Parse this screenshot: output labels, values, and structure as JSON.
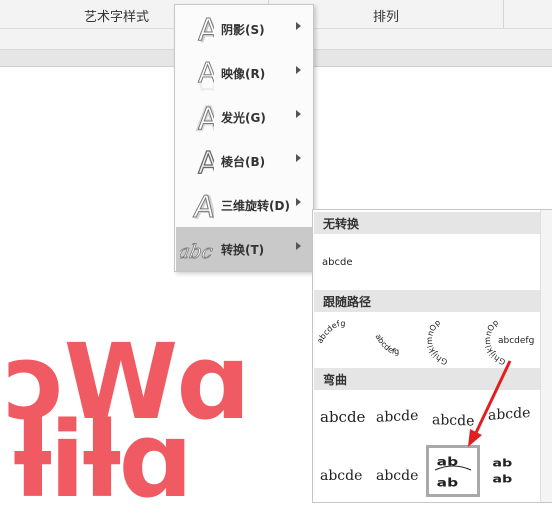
{
  "ribbon": {
    "group_wordart_styles": "艺术字样式",
    "group_arrange": "排列"
  },
  "canvas": {
    "line1": "ɔWɑ",
    "line2": "ƚiƚɑ",
    "text_color": "#f05a62"
  },
  "effects_menu": {
    "items": [
      {
        "label": "阴影(S)",
        "icon": "letter-a-shadow-icon"
      },
      {
        "label": "映像(R)",
        "icon": "letter-a-reflection-icon"
      },
      {
        "label": "发光(G)",
        "icon": "letter-a-glow-icon"
      },
      {
        "label": "棱台(B)",
        "icon": "letter-a-bevel-icon"
      },
      {
        "label": "三维旋转(D)",
        "icon": "letter-a-3d-rotation-icon"
      },
      {
        "label": "转换(T)",
        "icon": "abc-transform-icon"
      }
    ],
    "active_index": 5
  },
  "transform_menu": {
    "no_transform_heading": "无转换",
    "no_transform_sample": "abcde",
    "follow_path_heading": "跟随路径",
    "warp_heading": "弯曲",
    "warp_samples": [
      "abcde",
      "abcde",
      "abcde",
      "abcde",
      "abcde",
      "abcde"
    ],
    "follow_path_letters": "abcdefg",
    "follow_path_alt": "GhijklmnOp",
    "selected": "circle-warp-option"
  },
  "annotation": {
    "arrow_color": "#e02020"
  }
}
